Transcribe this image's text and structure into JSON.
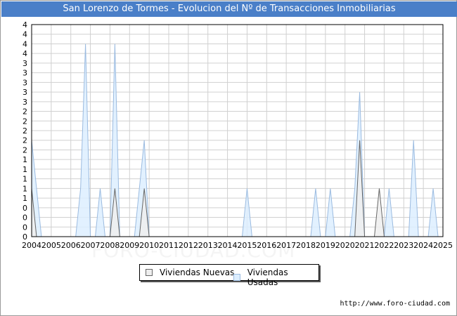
{
  "title": "San Lorenzo de Tormes - Evolucion del Nº de Transacciones Inmobiliarias",
  "source": "http://www.foro-ciudad.com",
  "watermark": "FORO-CIUDAD.COM",
  "colors": {
    "title_bg": "#4a7fc8",
    "grid": "#d0d0d0",
    "nuevas_fill": "#eeeeee",
    "nuevas_line": "#666666",
    "usadas_fill": "#ddeeff",
    "usadas_line": "#9bbbe0"
  },
  "chart_data": {
    "type": "area",
    "xlim": [
      2004,
      2025
    ],
    "ylim": [
      0,
      4.4
    ],
    "x_ticks": [
      "2004",
      "2005",
      "2006",
      "2007",
      "2008",
      "2009",
      "2010",
      "2011",
      "2012",
      "2013",
      "2014",
      "2015",
      "2016",
      "2017",
      "2018",
      "2019",
      "2020",
      "2021",
      "2022",
      "2023",
      "2024",
      "2025"
    ],
    "y_ticks": [
      "0",
      "0",
      "0",
      "0",
      "1",
      "1",
      "1",
      "1",
      "1",
      "2",
      "2",
      "2",
      "2",
      "2",
      "3",
      "3",
      "3",
      "3",
      "3",
      "4",
      "4",
      "4",
      "4"
    ],
    "series": [
      {
        "name": "Viviendas Nuevas",
        "points": [
          [
            2004,
            1
          ],
          [
            2004.25,
            0
          ],
          [
            2008,
            0
          ],
          [
            2008.25,
            1
          ],
          [
            2008.5,
            0
          ],
          [
            2009.5,
            0
          ],
          [
            2009.75,
            1
          ],
          [
            2010,
            0
          ],
          [
            2020.5,
            0
          ],
          [
            2020.75,
            2
          ],
          [
            2021,
            0
          ],
          [
            2021.5,
            0
          ],
          [
            2021.75,
            1
          ],
          [
            2022,
            0
          ]
        ]
      },
      {
        "name": "Viviendas Usadas",
        "points": [
          [
            2004,
            2
          ],
          [
            2004.5,
            0
          ],
          [
            2006.25,
            0
          ],
          [
            2006.5,
            1
          ],
          [
            2006.75,
            4
          ],
          [
            2007,
            0
          ],
          [
            2007.25,
            0
          ],
          [
            2007.5,
            1
          ],
          [
            2007.75,
            0
          ],
          [
            2008,
            0
          ],
          [
            2008.25,
            4
          ],
          [
            2008.5,
            0
          ],
          [
            2009.25,
            0
          ],
          [
            2009.5,
            1
          ],
          [
            2009.75,
            2
          ],
          [
            2010,
            0
          ],
          [
            2014.75,
            0
          ],
          [
            2015,
            1
          ],
          [
            2015.25,
            0
          ],
          [
            2018.25,
            0
          ],
          [
            2018.5,
            1
          ],
          [
            2018.75,
            0
          ],
          [
            2019,
            0
          ],
          [
            2019.25,
            1
          ],
          [
            2019.5,
            0
          ],
          [
            2020.25,
            0
          ],
          [
            2020.5,
            1
          ],
          [
            2020.75,
            3
          ],
          [
            2021,
            0
          ],
          [
            2022,
            0
          ],
          [
            2022.25,
            1
          ],
          [
            2022.5,
            0
          ],
          [
            2023.25,
            0
          ],
          [
            2023.5,
            2
          ],
          [
            2023.75,
            0
          ],
          [
            2024.25,
            0
          ],
          [
            2024.5,
            1
          ],
          [
            2024.75,
            0
          ]
        ]
      }
    ]
  }
}
